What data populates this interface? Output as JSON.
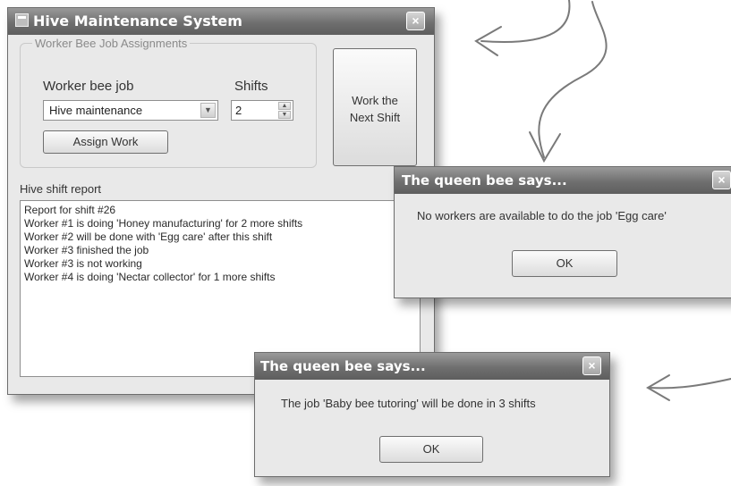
{
  "main_window": {
    "title": "Hive Maintenance System",
    "group_title": "Worker Bee Job Assignments",
    "job_label": "Worker bee job",
    "job_selected": "Hive maintenance",
    "shifts_label": "Shifts",
    "shifts_value": "2",
    "assign_button": "Assign Work",
    "work_next_button_line1": "Work the",
    "work_next_button_line2": "Next Shift",
    "report_label": "Hive shift report",
    "report_lines": [
      "Report for shift #26",
      "Worker #1 is doing 'Honey manufacturing' for 2 more shifts",
      "Worker #2 will be done with 'Egg care' after this shift",
      "Worker #3 finished the job",
      "Worker #3 is not working",
      "Worker #4 is doing 'Nectar collector' for 1 more shifts"
    ]
  },
  "dialog1": {
    "title": "The queen bee says...",
    "message": "No workers are available to do the job 'Egg care'",
    "ok_label": "OK"
  },
  "dialog2": {
    "title": "The queen bee says...",
    "message": "The job 'Baby bee tutoring' will be done in 3 shifts",
    "ok_label": "OK"
  }
}
